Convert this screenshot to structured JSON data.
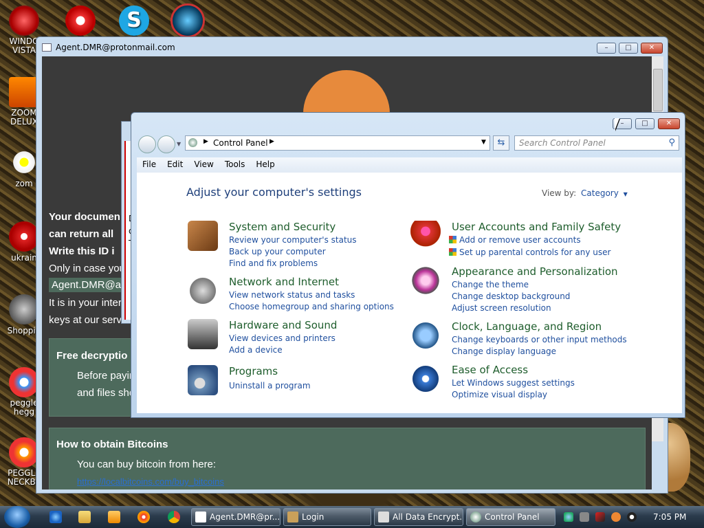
{
  "desktop_icons": [
    {
      "label": "WINDO\nVISTA",
      "icon": "windows-vista-icon"
    },
    {
      "label": "ZOOM\nDELUX",
      "icon": "zuma-deluxe-icon"
    },
    {
      "label": "zom",
      "icon": "flower-icon"
    },
    {
      "label": "ukrain",
      "icon": "radiation-icon"
    },
    {
      "label": "Shoppin",
      "icon": "flash-icon"
    },
    {
      "label": "peggle\nhegg",
      "icon": "peggle-icon"
    },
    {
      "label": "PEGGLE\nNECKBE",
      "icon": "peggle-icon"
    }
  ],
  "ransom_window": {
    "title": "Agent.DMR@protonmail.com",
    "lines": {
      "line1": "Your documen",
      "line2": "can return all",
      "line3": "Write this ID i",
      "line4": "Only in case you",
      "email_box": "Agent.DMR@ac",
      "line5": "It is in your inter",
      "line6": "keys at our serv"
    },
    "free_decryption": {
      "heading": "Free decryptio",
      "text1": "Before payin",
      "text2": "and files sho"
    },
    "obtain_bitcoins": {
      "heading": "How to obtain Bitcoins",
      "text": "You can buy bitcoin from here:",
      "link": "https://localbitcoins.com/buy_bitcoins"
    },
    "hidden_window_fragment": {
      "l1": "D",
      "l2": "o",
      "l3": "T"
    }
  },
  "control_panel": {
    "breadcrumb": "Control Panel",
    "search_placeholder": "Search Control Panel",
    "menu": [
      "File",
      "Edit",
      "View",
      "Tools",
      "Help"
    ],
    "heading": "Adjust your computer's settings",
    "view_by_label": "View by:",
    "view_by_value": "Category",
    "categories": [
      {
        "title": "System and Security",
        "icon": "system-security-icon",
        "links": [
          "Review your computer's status",
          "Back up your computer",
          "Find and fix problems"
        ]
      },
      {
        "title": "Network and Internet",
        "icon": "network-icon",
        "links": [
          "View network status and tasks",
          "Choose homegroup and sharing options"
        ]
      },
      {
        "title": "Hardware and Sound",
        "icon": "hardware-sound-icon",
        "links": [
          "View devices and printers",
          "Add a device"
        ]
      },
      {
        "title": "Programs",
        "icon": "programs-icon",
        "links": [
          "Uninstall a program"
        ]
      },
      {
        "title": "User Accounts and Family Safety",
        "icon": "user-accounts-icon",
        "links": [
          "Add or remove user accounts",
          "Set up parental controls for any user"
        ]
      },
      {
        "title": "Appearance and Personalization",
        "icon": "appearance-icon",
        "links": [
          "Change the theme",
          "Change desktop background",
          "Adjust screen resolution"
        ]
      },
      {
        "title": "Clock, Language, and Region",
        "icon": "clock-icon",
        "links": [
          "Change keyboards or other input methods",
          "Change display language"
        ]
      },
      {
        "title": "Ease of Access",
        "icon": "ease-of-access-icon",
        "links": [
          "Let Windows suggest settings",
          "Optimize visual display"
        ]
      }
    ]
  },
  "taskbar": {
    "buttons": [
      "Agent.DMR@pr...",
      "Login",
      "All Data Encrypt...",
      "Control Panel"
    ],
    "clock": "7:05 PM"
  },
  "colors": {
    "category_title": "#1e5d2c",
    "link": "#1f4f9e",
    "heading": "#1e3f7a",
    "ransom_box": "#4d6a5c"
  }
}
